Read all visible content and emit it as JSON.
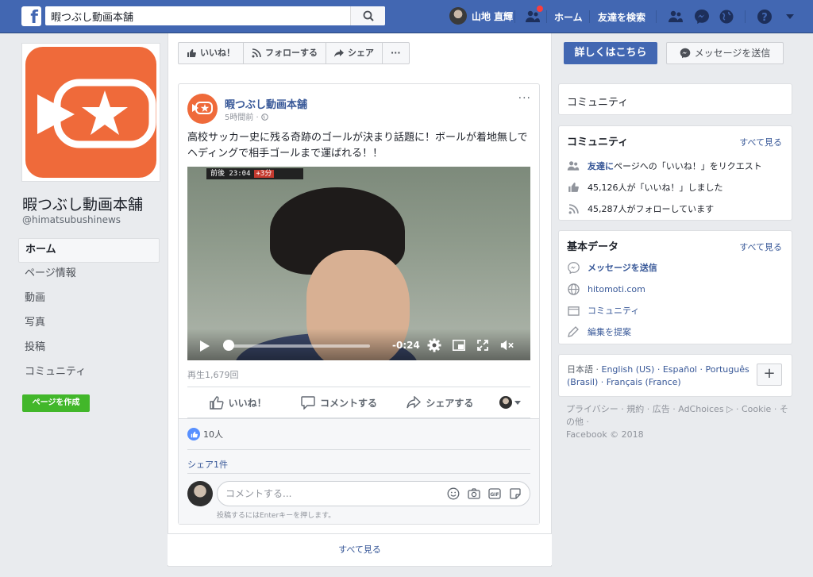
{
  "topbar": {
    "search_value": "暇つぶし動画本舗",
    "user_name": "山地 直輝",
    "home": "ホーム",
    "find_friends": "友達を検索"
  },
  "left": {
    "page_name": "暇つぶし動画本舗",
    "page_handle": "@himatsubushinews",
    "nav": [
      "ホーム",
      "ページ情報",
      "動画",
      "写真",
      "投稿",
      "コミュニティ"
    ],
    "create_page": "ページを作成"
  },
  "actions": {
    "like": "いいね！",
    "follow": "フォローする",
    "share": "シェア",
    "more": "···",
    "learn_more": "詳しくはこちら",
    "send_message": "メッセージを送信"
  },
  "post": {
    "author": "暇つぶし動画本舗",
    "time": "5時間前 ·",
    "text": "高校サッカー史に残る奇跡のゴールが決まり話題に！ボールが着地無しでヘディングで相手ゴールまで運ばれる！！",
    "video": {
      "scoreboard_time": "前後 23:04",
      "scoreboard_badge": "+3分",
      "time_remaining": "-0:24",
      "progress": 0.02
    },
    "views": "再生1,679回",
    "like_btn": "いいね！",
    "comment_btn": "コメントする",
    "share_btn": "シェアする",
    "likes_count": "10人",
    "shares": "シェア1件",
    "comment_placeholder": "コメントする...",
    "enter_hint": "投稿するにはEnterキーを押します。",
    "see_all": "すべて見る"
  },
  "right": {
    "community_header": "コミュニティ",
    "community": {
      "title": "コミュニティ",
      "see_all": "すべて見る",
      "invite_link": "友達に",
      "invite_rest": "ページへの「いいね！」をリクエスト",
      "likes": "45,126人が「いいね！」しました",
      "follows": "45,287人がフォローしています"
    },
    "about": {
      "title": "基本データ",
      "see_all": "すべて見る",
      "message": "メッセージを送信",
      "website": "hitomoti.com",
      "category": "コミュニティ",
      "suggest": "編集を提案"
    },
    "languages": {
      "current": "日本語 · ",
      "options": "English (US) · Español · Português (Brasil) · Français (France)",
      "add": "+"
    },
    "footer": "プライバシー · 規約 · 広告 · AdChoices ▷ · Cookie · その他 ·",
    "copyright": "Facebook © 2018"
  },
  "colors": {
    "brand_blue": "#4267b2",
    "link_blue": "#385898",
    "green": "#42b72a",
    "logo_orange": "#ef6a3a"
  }
}
